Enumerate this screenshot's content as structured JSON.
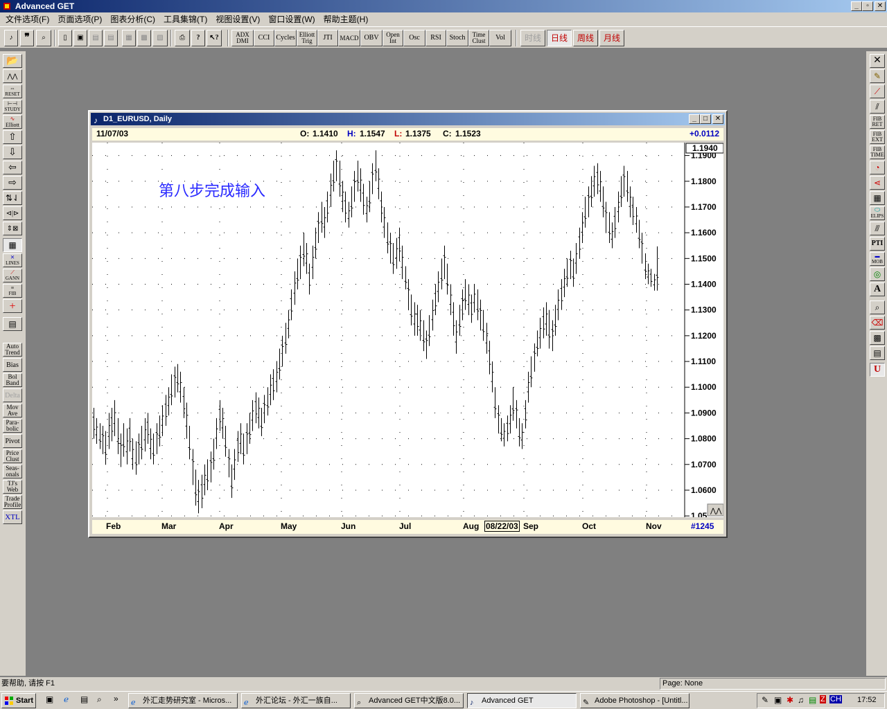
{
  "app": {
    "title": "Advanced GET"
  },
  "menu": [
    "文件选项(F)",
    "页面选项(P)",
    "图表分析(C)",
    "工具集锦(T)",
    "视图设置(V)",
    "窗口设置(W)",
    "帮助主题(H)"
  ],
  "toolbar": {
    "indicators": [
      "ADX DMI",
      "CCI",
      "Cycles",
      "Elliott Trig",
      "JTI",
      "MACD",
      "OBV",
      "Open Int",
      "Osc",
      "RSI",
      "Stoch",
      "Time Clust",
      "Vol"
    ],
    "timeframes": [
      "时线",
      "日线",
      "周线",
      "月线"
    ]
  },
  "left_toolbar": {
    "labels": [
      "RESET",
      "STUDY",
      "Elliott",
      "LINES",
      "GANN",
      "FIB",
      "Auto Trend",
      "Bias",
      "Bol Band",
      "Delta",
      "Mov Ave",
      "Para-bolic",
      "Pivot",
      "Price Clust",
      "Seas-onals",
      "TJ's Web",
      "Trade Profile",
      "XTL"
    ]
  },
  "right_toolbar": {
    "labels": [
      "FIB RET",
      "FIB EXT",
      "FIB TIME",
      "ELIPS",
      "PTI",
      "MOB",
      "A",
      "U"
    ]
  },
  "chart_window": {
    "title": "D1_EURUSD, Daily",
    "quote": {
      "date": "11/07/03",
      "open_label": "O:",
      "open": "1.1410",
      "high_label": "H:",
      "high": "1.1547",
      "low_label": "L:",
      "low": "1.1375",
      "close_label": "C:",
      "close": "1.1523",
      "change": "+0.0112"
    },
    "annotation": "第八步完成输入",
    "current_price_label": "1.1940",
    "cursor_date": "08/22/03",
    "bar_count": "#1245"
  },
  "chart_data": {
    "type": "bar",
    "title": "D1_EURUSD, Daily",
    "xlabel": "",
    "ylabel": "",
    "x_tick_labels": [
      "Feb",
      "Mar",
      "Apr",
      "May",
      "Jun",
      "Jul",
      "Aug",
      "Sep",
      "Oct",
      "Nov"
    ],
    "y_tick_labels": [
      "1.1900",
      "1.1800",
      "1.1700",
      "1.1600",
      "1.1500",
      "1.1400",
      "1.1300",
      "1.1200",
      "1.1100",
      "1.1000",
      "1.0900",
      "1.0800",
      "1.0700",
      "1.0600",
      "1.05"
    ],
    "ylim": [
      1.0495,
      1.195
    ],
    "grid": true,
    "series": [
      {
        "values": [
          [
            1.092,
            1.08
          ],
          [
            1.088,
            1.078
          ],
          [
            1.086,
            1.076
          ],
          [
            1.085,
            1.074
          ],
          [
            1.083,
            1.07
          ],
          [
            1.09,
            1.076
          ],
          [
            1.092,
            1.079
          ],
          [
            1.095,
            1.081
          ],
          [
            1.088,
            1.074
          ],
          [
            1.082,
            1.069
          ],
          [
            1.086,
            1.073
          ],
          [
            1.084,
            1.07
          ],
          [
            1.088,
            1.075
          ],
          [
            1.08,
            1.068
          ],
          [
            1.079,
            1.066
          ],
          [
            1.082,
            1.07
          ],
          [
            1.085,
            1.072
          ],
          [
            1.088,
            1.075
          ],
          [
            1.09,
            1.078
          ],
          [
            1.084,
            1.072
          ],
          [
            1.082,
            1.07
          ],
          [
            1.086,
            1.074
          ],
          [
            1.089,
            1.077
          ],
          [
            1.093,
            1.081
          ],
          [
            1.097,
            1.085
          ],
          [
            1.1,
            1.089
          ],
          [
            1.105,
            1.093
          ],
          [
            1.108,
            1.096
          ],
          [
            1.109,
            1.098
          ],
          [
            1.106,
            1.094
          ],
          [
            1.1,
            1.088
          ],
          [
            1.094,
            1.08
          ],
          [
            1.085,
            1.072
          ],
          [
            1.076,
            1.062
          ],
          [
            1.068,
            1.054
          ],
          [
            1.064,
            1.051
          ],
          [
            1.066,
            1.053
          ],
          [
            1.07,
            1.058
          ],
          [
            1.072,
            1.06
          ],
          [
            1.075,
            1.063
          ],
          [
            1.08,
            1.068
          ],
          [
            1.088,
            1.076
          ],
          [
            1.095,
            1.083
          ],
          [
            1.092,
            1.08
          ],
          [
            1.085,
            1.073
          ],
          [
            1.076,
            1.065
          ],
          [
            1.07,
            1.057
          ],
          [
            1.076,
            1.064
          ],
          [
            1.083,
            1.071
          ],
          [
            1.086,
            1.074
          ],
          [
            1.082,
            1.07
          ],
          [
            1.086,
            1.074
          ],
          [
            1.09,
            1.078
          ],
          [
            1.095,
            1.083
          ],
          [
            1.098,
            1.086
          ],
          [
            1.096,
            1.084
          ],
          [
            1.092,
            1.081
          ],
          [
            1.097,
            1.086
          ],
          [
            1.1,
            1.089
          ],
          [
            1.105,
            1.093
          ],
          [
            1.107,
            1.095
          ],
          [
            1.11,
            1.098
          ],
          [
            1.115,
            1.103
          ],
          [
            1.12,
            1.108
          ],
          [
            1.125,
            1.113
          ],
          [
            1.13,
            1.119
          ],
          [
            1.138,
            1.126
          ],
          [
            1.145,
            1.132
          ],
          [
            1.15,
            1.138
          ],
          [
            1.155,
            1.142
          ],
          [
            1.16,
            1.147
          ],
          [
            1.156,
            1.144
          ],
          [
            1.148,
            1.136
          ],
          [
            1.155,
            1.142
          ],
          [
            1.162,
            1.15
          ],
          [
            1.168,
            1.156
          ],
          [
            1.172,
            1.16
          ],
          [
            1.17,
            1.158
          ],
          [
            1.176,
            1.164
          ],
          [
            1.183,
            1.17
          ],
          [
            1.188,
            1.176
          ],
          [
            1.192,
            1.18
          ],
          [
            1.188,
            1.174
          ],
          [
            1.18,
            1.168
          ],
          [
            1.176,
            1.164
          ],
          [
            1.172,
            1.162
          ],
          [
            1.178,
            1.166
          ],
          [
            1.184,
            1.172
          ],
          [
            1.188,
            1.176
          ],
          [
            1.185,
            1.172
          ],
          [
            1.179,
            1.167
          ],
          [
            1.174,
            1.164
          ],
          [
            1.18,
            1.168
          ],
          [
            1.187,
            1.175
          ],
          [
            1.192,
            1.18
          ],
          [
            1.185,
            1.173
          ],
          [
            1.176,
            1.164
          ],
          [
            1.17,
            1.158
          ],
          [
            1.164,
            1.152
          ],
          [
            1.16,
            1.148
          ],
          [
            1.156,
            1.144
          ],
          [
            1.158,
            1.146
          ],
          [
            1.162,
            1.149
          ],
          [
            1.155,
            1.142
          ],
          [
            1.147,
            1.138
          ],
          [
            1.142,
            1.13
          ],
          [
            1.136,
            1.124
          ],
          [
            1.133,
            1.12
          ],
          [
            1.132,
            1.12
          ],
          [
            1.13,
            1.118
          ],
          [
            1.126,
            1.114
          ],
          [
            1.122,
            1.111
          ],
          [
            1.128,
            1.116
          ],
          [
            1.134,
            1.122
          ],
          [
            1.14,
            1.128
          ],
          [
            1.145,
            1.133
          ],
          [
            1.15,
            1.138
          ],
          [
            1.155,
            1.142
          ],
          [
            1.148,
            1.136
          ],
          [
            1.14,
            1.128
          ],
          [
            1.133,
            1.12
          ],
          [
            1.126,
            1.113
          ],
          [
            1.132,
            1.12
          ],
          [
            1.138,
            1.126
          ],
          [
            1.142,
            1.13
          ],
          [
            1.14,
            1.128
          ],
          [
            1.136,
            1.125
          ],
          [
            1.14,
            1.129
          ],
          [
            1.138,
            1.126
          ],
          [
            1.134,
            1.122
          ],
          [
            1.13,
            1.118
          ],
          [
            1.125,
            1.113
          ],
          [
            1.118,
            1.105
          ],
          [
            1.11,
            1.098
          ],
          [
            1.1,
            1.088
          ],
          [
            1.093,
            1.082
          ],
          [
            1.088,
            1.079
          ],
          [
            1.086,
            1.077
          ],
          [
            1.089,
            1.079
          ],
          [
            1.093,
            1.082
          ],
          [
            1.1,
            1.087
          ],
          [
            1.095,
            1.084
          ],
          [
            1.088,
            1.077
          ],
          [
            1.086,
            1.076
          ],
          [
            1.095,
            1.084
          ],
          [
            1.106,
            1.094
          ],
          [
            1.112,
            1.1
          ],
          [
            1.117,
            1.106
          ],
          [
            1.122,
            1.112
          ],
          [
            1.127,
            1.115
          ],
          [
            1.131,
            1.119
          ],
          [
            1.133,
            1.12
          ],
          [
            1.13,
            1.115
          ],
          [
            1.126,
            1.114
          ],
          [
            1.132,
            1.12
          ],
          [
            1.138,
            1.126
          ],
          [
            1.142,
            1.13
          ],
          [
            1.146,
            1.135
          ],
          [
            1.15,
            1.139
          ],
          [
            1.153,
            1.142
          ],
          [
            1.15,
            1.139
          ],
          [
            1.156,
            1.144
          ],
          [
            1.162,
            1.15
          ],
          [
            1.168,
            1.156
          ],
          [
            1.174,
            1.162
          ],
          [
            1.178,
            1.166
          ],
          [
            1.182,
            1.17
          ],
          [
            1.186,
            1.174
          ],
          [
            1.187,
            1.175
          ],
          [
            1.184,
            1.172
          ],
          [
            1.178,
            1.166
          ],
          [
            1.172,
            1.16
          ],
          [
            1.168,
            1.156
          ],
          [
            1.164,
            1.154
          ],
          [
            1.17,
            1.158
          ],
          [
            1.176,
            1.164
          ],
          [
            1.182,
            1.17
          ],
          [
            1.186,
            1.174
          ],
          [
            1.184,
            1.172
          ],
          [
            1.178,
            1.166
          ],
          [
            1.174,
            1.163
          ],
          [
            1.17,
            1.16
          ],
          [
            1.165,
            1.154
          ],
          [
            1.16,
            1.148
          ],
          [
            1.152,
            1.142
          ],
          [
            1.148,
            1.14
          ],
          [
            1.146,
            1.139
          ],
          [
            1.144,
            1.1375
          ],
          [
            1.1547,
            1.1375
          ]
        ]
      }
    ]
  },
  "status": {
    "help": "要帮助, 请按 F1",
    "page": "Page: None"
  },
  "taskbar": {
    "start": "Start",
    "tasks": [
      "外汇走势研究室 - Micros...",
      "外汇论坛 - 外汇一族自...",
      "Advanced GET中文版8.0...",
      "Advanced GET",
      "Adobe Photoshop - [Untitl..."
    ],
    "clock": "17:52",
    "lang": "CH"
  }
}
